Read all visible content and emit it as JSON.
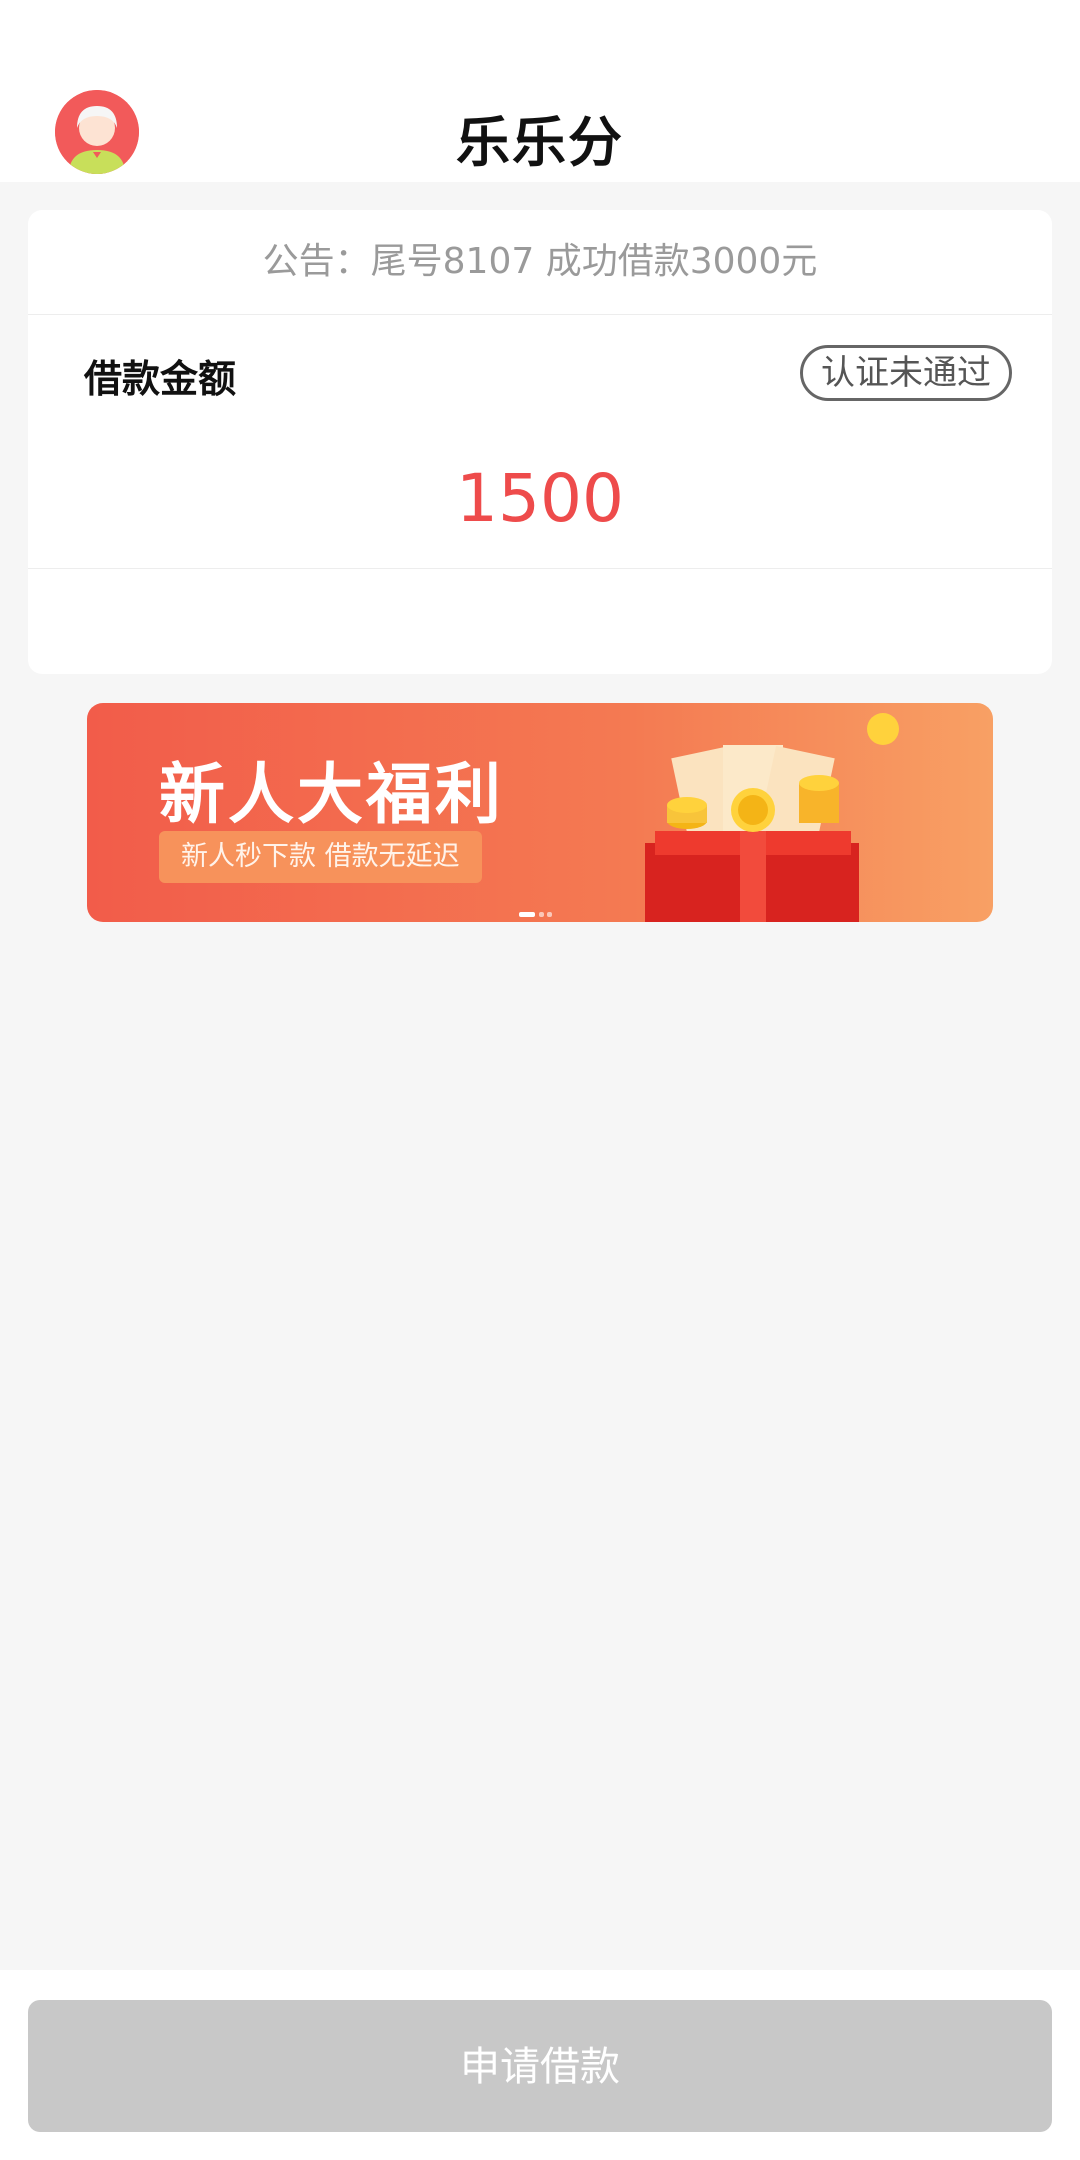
{
  "header": {
    "title": "乐乐分"
  },
  "notice": {
    "text": "公告：尾号8107 成功借款3000元"
  },
  "loan": {
    "label": "借款金额",
    "status": "认证未通过",
    "amount": "1500"
  },
  "banner": {
    "title": "新人大福利",
    "subtitle": "新人秒下款  借款无延迟",
    "slide_index": 1,
    "slide_count": 3
  },
  "apply_button": {
    "label": "申请借款"
  },
  "colors": {
    "accent": "#ee4b4b",
    "button_disabled": "#c8c8c8",
    "page_bg": "#f6f6f6"
  },
  "icons": {
    "avatar": "user-avatar-icon"
  }
}
